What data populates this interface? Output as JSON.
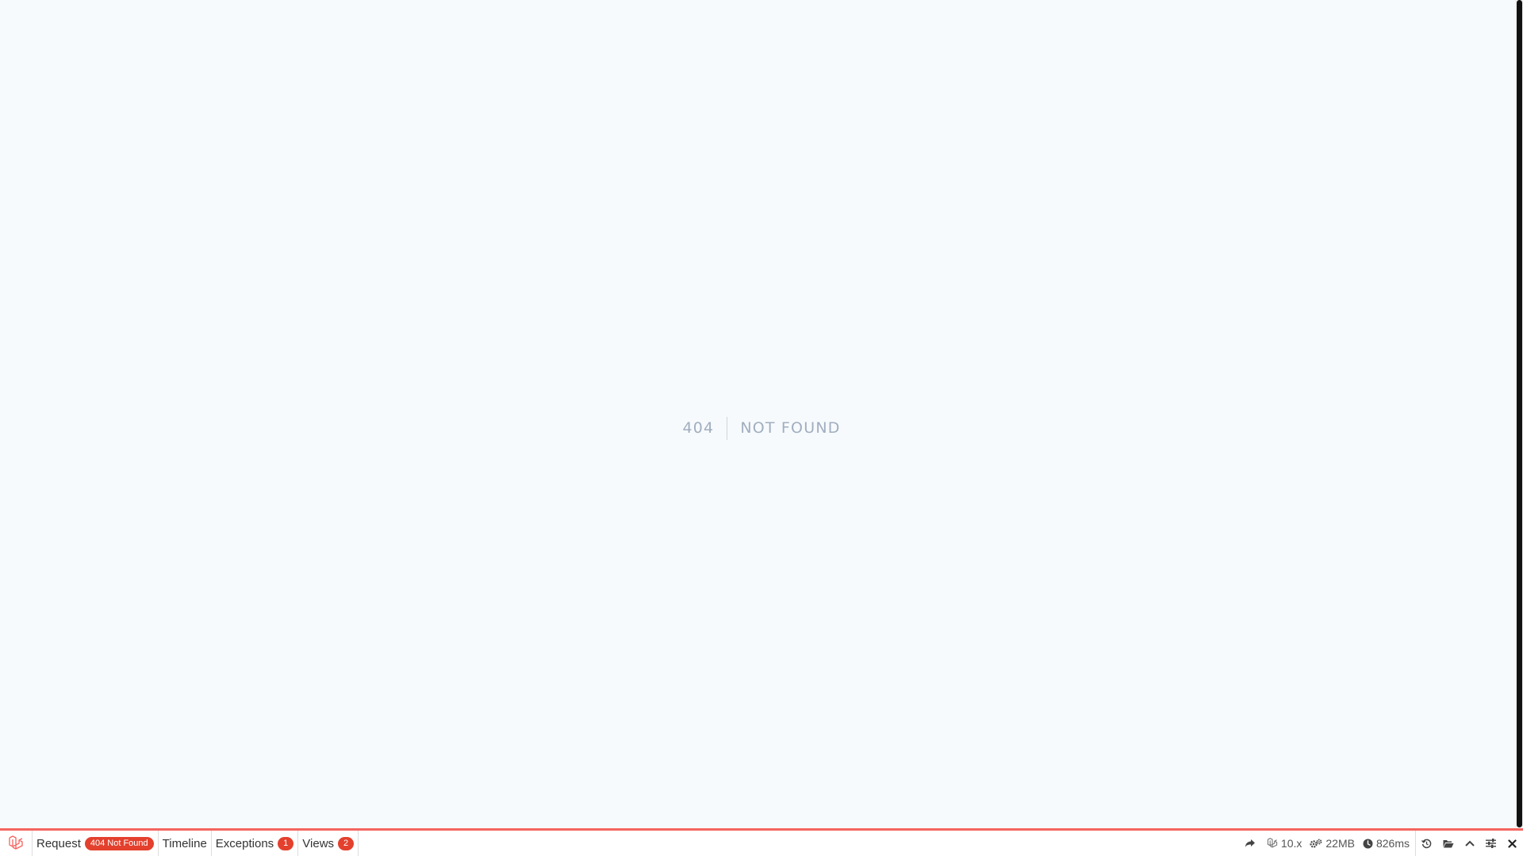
{
  "error": {
    "code": "404",
    "message": "Not Found"
  },
  "debugbar": {
    "tabs": {
      "request": {
        "label": "Request",
        "badge": "404 Not Found"
      },
      "timeline": {
        "label": "Timeline"
      },
      "exceptions": {
        "label": "Exceptions",
        "badge": "1"
      },
      "views": {
        "label": "Views",
        "badge": "2"
      }
    },
    "indicators": {
      "version": "10.x",
      "memory": "22MB",
      "time": "826ms"
    },
    "icons": {
      "logo": "laravel-logo-icon",
      "redirect": "share-arrow-icon",
      "version": "laravel-icon",
      "memory": "cogs-icon",
      "time": "clock-icon",
      "history": "history-icon",
      "open": "folder-open-icon",
      "minimize": "chevron-up-icon",
      "settings": "sliders-icon",
      "close": "close-icon"
    },
    "colors": {
      "accent": "#f4645f",
      "badge": "#e3402d",
      "background": "#f7fafc"
    }
  }
}
